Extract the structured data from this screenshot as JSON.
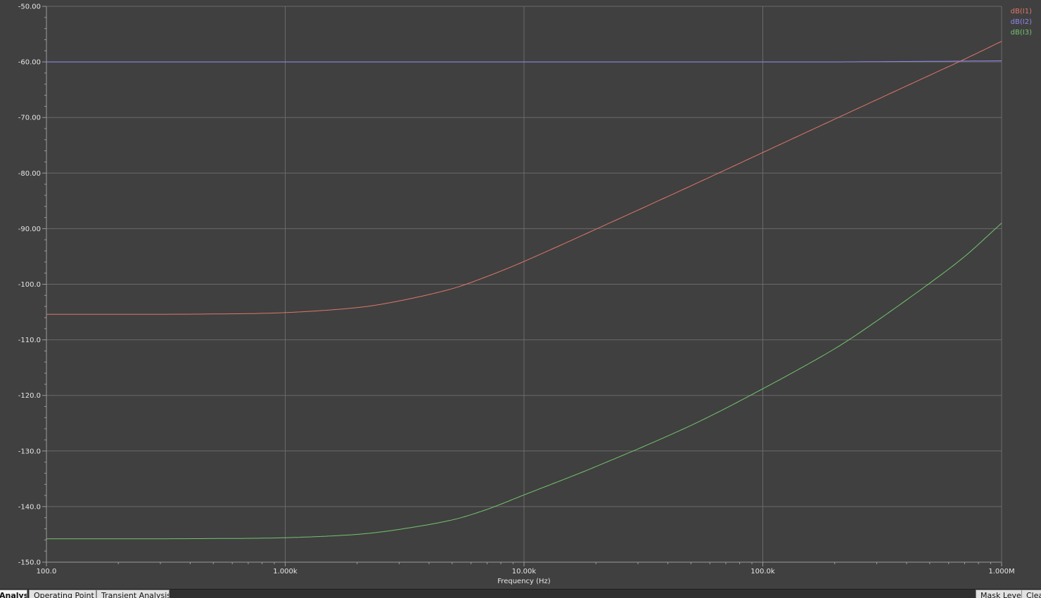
{
  "colors": {
    "background": "#404040",
    "plot_background": "#404040",
    "grid": "#6a6a6a",
    "axis": "#9a9a9a",
    "tick_text": "#e6e6e6",
    "series_1": "#e0766a",
    "series_2": "#8f86f0",
    "series_3": "#74c46e"
  },
  "chart_data": {
    "type": "line",
    "xlabel": "Frequency (Hz)",
    "ylabel": "",
    "x_scale": "log",
    "xlim": [
      100,
      1000000
    ],
    "ylim": [
      -150,
      -50
    ],
    "grid": true,
    "legend_position": "top-right",
    "x_ticks": [
      {
        "value": 100,
        "label": "100.0"
      },
      {
        "value": 1000,
        "label": "1.000k"
      },
      {
        "value": 10000,
        "label": "10.00k"
      },
      {
        "value": 100000,
        "label": "100.0k"
      },
      {
        "value": 1000000,
        "label": "1.000M"
      }
    ],
    "y_ticks": [
      {
        "value": -50,
        "label": "-50.00"
      },
      {
        "value": -60,
        "label": "-60.00"
      },
      {
        "value": -70,
        "label": "-70.00"
      },
      {
        "value": -80,
        "label": "-80.00"
      },
      {
        "value": -90,
        "label": "-90.00"
      },
      {
        "value": -100,
        "label": "-100.0"
      },
      {
        "value": -110,
        "label": "-110.0"
      },
      {
        "value": -120,
        "label": "-120.0"
      },
      {
        "value": -130,
        "label": "-130.0"
      },
      {
        "value": -140,
        "label": "-140.0"
      },
      {
        "value": -150,
        "label": "-150.0"
      }
    ],
    "x": [
      100,
      200,
      500,
      1000,
      2000,
      3000,
      5000,
      7000,
      10000,
      20000,
      50000,
      100000,
      200000,
      300000,
      500000,
      700000,
      1000000
    ],
    "series": [
      {
        "name": "dB(I1)",
        "color": "#e0766a",
        "values": [
          -105.4,
          -105.4,
          -105.35,
          -105.1,
          -104.2,
          -103.0,
          -100.8,
          -98.6,
          -95.9,
          -90.1,
          -82.3,
          -76.3,
          -70.3,
          -66.8,
          -62.4,
          -59.5,
          -56.3
        ]
      },
      {
        "name": "dB(I2)",
        "color": "#8f86f0",
        "values": [
          -60.0,
          -60.0,
          -60.0,
          -60.0,
          -60.0,
          -60.0,
          -60.0,
          -60.0,
          -60.0,
          -60.0,
          -60.0,
          -60.0,
          -60.0,
          -59.95,
          -59.9,
          -59.85,
          -59.8
        ]
      },
      {
        "name": "dB(I3)",
        "color": "#74c46e",
        "values": [
          -145.8,
          -145.8,
          -145.75,
          -145.6,
          -145.0,
          -144.1,
          -142.4,
          -140.5,
          -137.9,
          -132.8,
          -125.4,
          -118.8,
          -111.6,
          -106.6,
          -99.8,
          -95.0,
          -89.0
        ]
      }
    ]
  },
  "tabs": [
    {
      "label": "Analysis",
      "active": true
    },
    {
      "label": "Operating Point",
      "active": false
    },
    {
      "label": "Transient Analysis",
      "active": false
    }
  ],
  "right_tabs": [
    {
      "label": "Mask Level"
    },
    {
      "label": "Clear"
    }
  ]
}
